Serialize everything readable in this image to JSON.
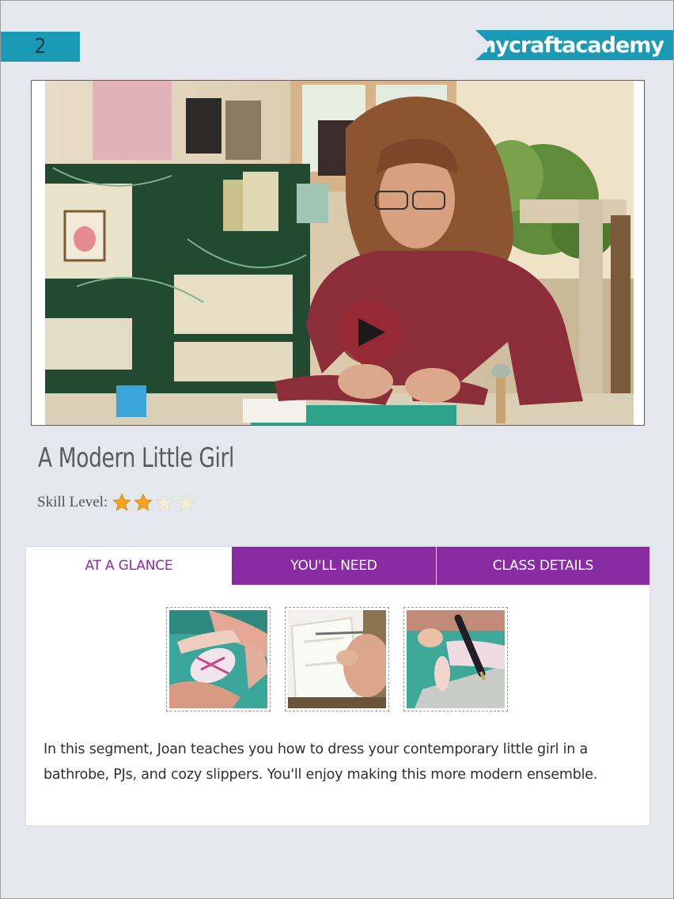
{
  "header": {
    "page_number": "2",
    "logo_text": "mycraftacademy",
    "brand_color": "#1b9ab5"
  },
  "video": {
    "play_icon": "play-icon"
  },
  "lesson": {
    "title": "A Modern Little Girl",
    "skill_label": "Skill Level:",
    "skill_rating": 2,
    "skill_max": 4
  },
  "tabs": [
    {
      "label": "AT A GLANCE",
      "active": true
    },
    {
      "label": "YOU'LL NEED",
      "active": false
    },
    {
      "label": "CLASS DETAILS",
      "active": false
    }
  ],
  "accent_color": "#8b2ba4",
  "thumbnails_count": 3,
  "description": "In this segment, Joan teaches you how to dress your contemporary little girl in a bathrobe, PJs, and cozy slippers. You'll enjoy making this more modern ensemble."
}
